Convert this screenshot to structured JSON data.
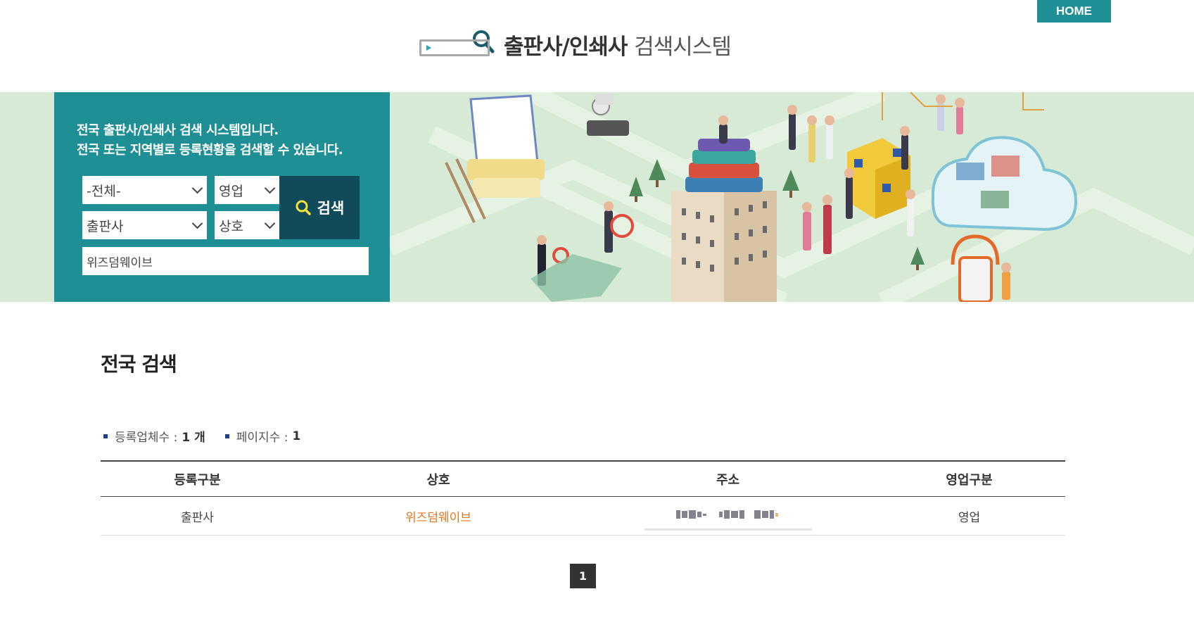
{
  "header": {
    "home_label": "HOME",
    "title_bold": "출판사/인쇄사",
    "title_light": "검색시스템"
  },
  "search": {
    "intro_line1": "전국 출판사/인쇄사 검색 시스템입니다.",
    "intro_line2": "전국 또는 지역별로 등록현황을 검색할 수 있습니다.",
    "region_value": "-전체-",
    "status_value": "영업",
    "category_value": "출판사",
    "field_value": "상호",
    "button_label": "검색",
    "keyword_value": "위즈덤웨이브"
  },
  "main": {
    "section_title": "전국 검색",
    "stats": {
      "count_label": "등록업체수 :",
      "count_value": "1 개",
      "pages_label": "페이지수 :",
      "pages_value": "1"
    },
    "table": {
      "headers": [
        "등록구분",
        "상호",
        "주소",
        "영업구분"
      ],
      "rows": [
        {
          "category": "출판사",
          "name": "위즈덤웨이브",
          "address": "",
          "status": "영업"
        }
      ]
    },
    "pagination": {
      "current": "1"
    }
  },
  "colors": {
    "brand_teal": "#1f8f96",
    "search_dark": "#114a5b",
    "banner_bg": "#d7ead6",
    "link_orange": "#e0761e"
  }
}
